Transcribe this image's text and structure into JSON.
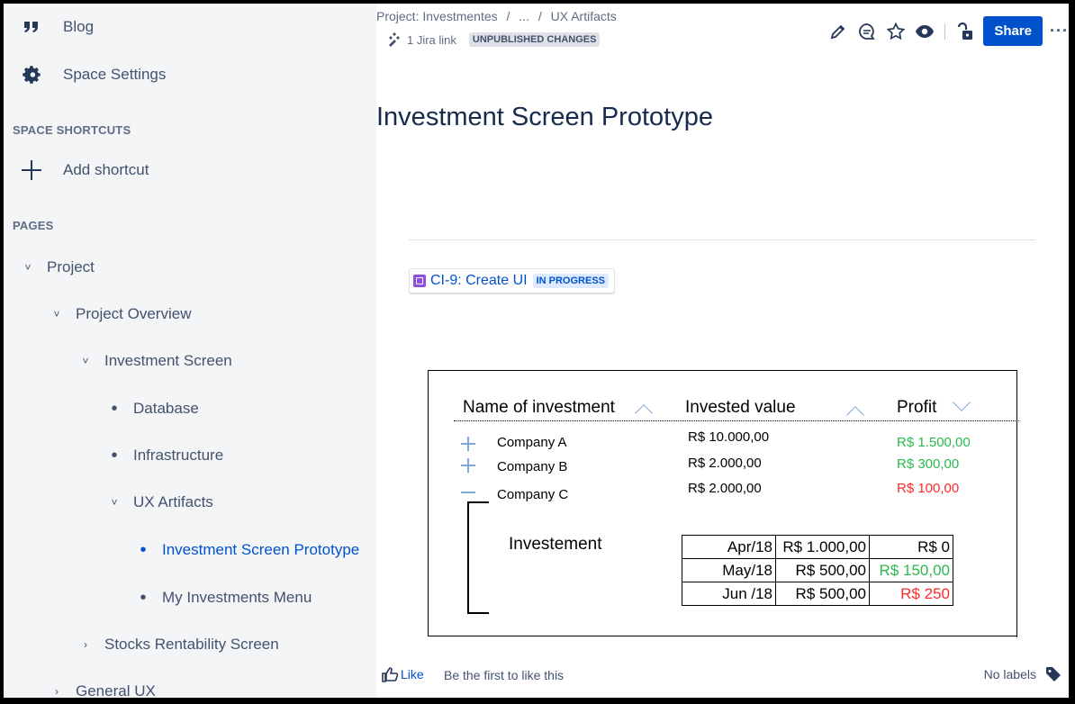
{
  "sidebar": {
    "blog_label": "Blog",
    "space_settings_label": "Space Settings",
    "shortcuts_heading": "SPACE SHORTCUTS",
    "add_shortcut_label": "Add shortcut",
    "pages_heading": "PAGES",
    "tree": {
      "project": "Project",
      "project_overview": "Project Overview",
      "investment_screen": "Investment Screen",
      "database": "Database",
      "infrastructure": "Infrastructure",
      "ux_artifacts": "UX Artifacts",
      "investment_screen_prototype": "Investment Screen Prototype",
      "my_investments_menu": "My Investments Menu",
      "stocks_rentability_screen": "Stocks Rentability Screen",
      "general_ux": "General UX"
    }
  },
  "header": {
    "breadcrumb": [
      "Project: Investmentes",
      "/",
      "...",
      "/",
      "UX Artifacts"
    ],
    "jira_link_label": "1 Jira link",
    "unpublished_label": "UNPUBLISHED CHANGES",
    "share_label": "Share",
    "more_label": "···"
  },
  "page": {
    "title": "Investment Screen Prototype",
    "jira_issue_key": "CI-9: Create UI",
    "jira_issue_status": "IN PROGRESS"
  },
  "prototype": {
    "headers": {
      "name": "Name of investment",
      "invested": "Invested value",
      "profit": "Profit"
    },
    "rows": [
      {
        "company": "Company A",
        "invested": "R$ 10.000,00",
        "profit": "R$ 1.500,00",
        "profit_color": "#2db84d",
        "expander": "+"
      },
      {
        "company": "Company B",
        "invested": "R$ 2.000,00",
        "profit": "R$ 300,00",
        "profit_color": "#2db84d",
        "expander": "+"
      },
      {
        "company": "Company C",
        "invested": "R$ 2.000,00",
        "profit": "R$ 100,00",
        "profit_color": "#ff2a2a",
        "expander": "−"
      }
    ],
    "detail_label": "Investement",
    "detail_rows": [
      {
        "month": "Apr/18",
        "value": "R$ 1.000,00",
        "profit": "R$ 0"
      },
      {
        "month": "May/18",
        "value": "R$ 500,00",
        "profit": "R$ 150,00"
      },
      {
        "month": "Jun /18",
        "value": "R$ 500,00",
        "profit": "R$ 250"
      }
    ]
  },
  "footer": {
    "like_label": "Like",
    "like_prompt": "Be the first to like this",
    "labels_text": "No labels"
  },
  "colors": {
    "accent": "#0052cc",
    "sidebar_bg": "#f4f5f7",
    "profit_positive": "#2db84d",
    "profit_negative": "#ff2a2a"
  }
}
